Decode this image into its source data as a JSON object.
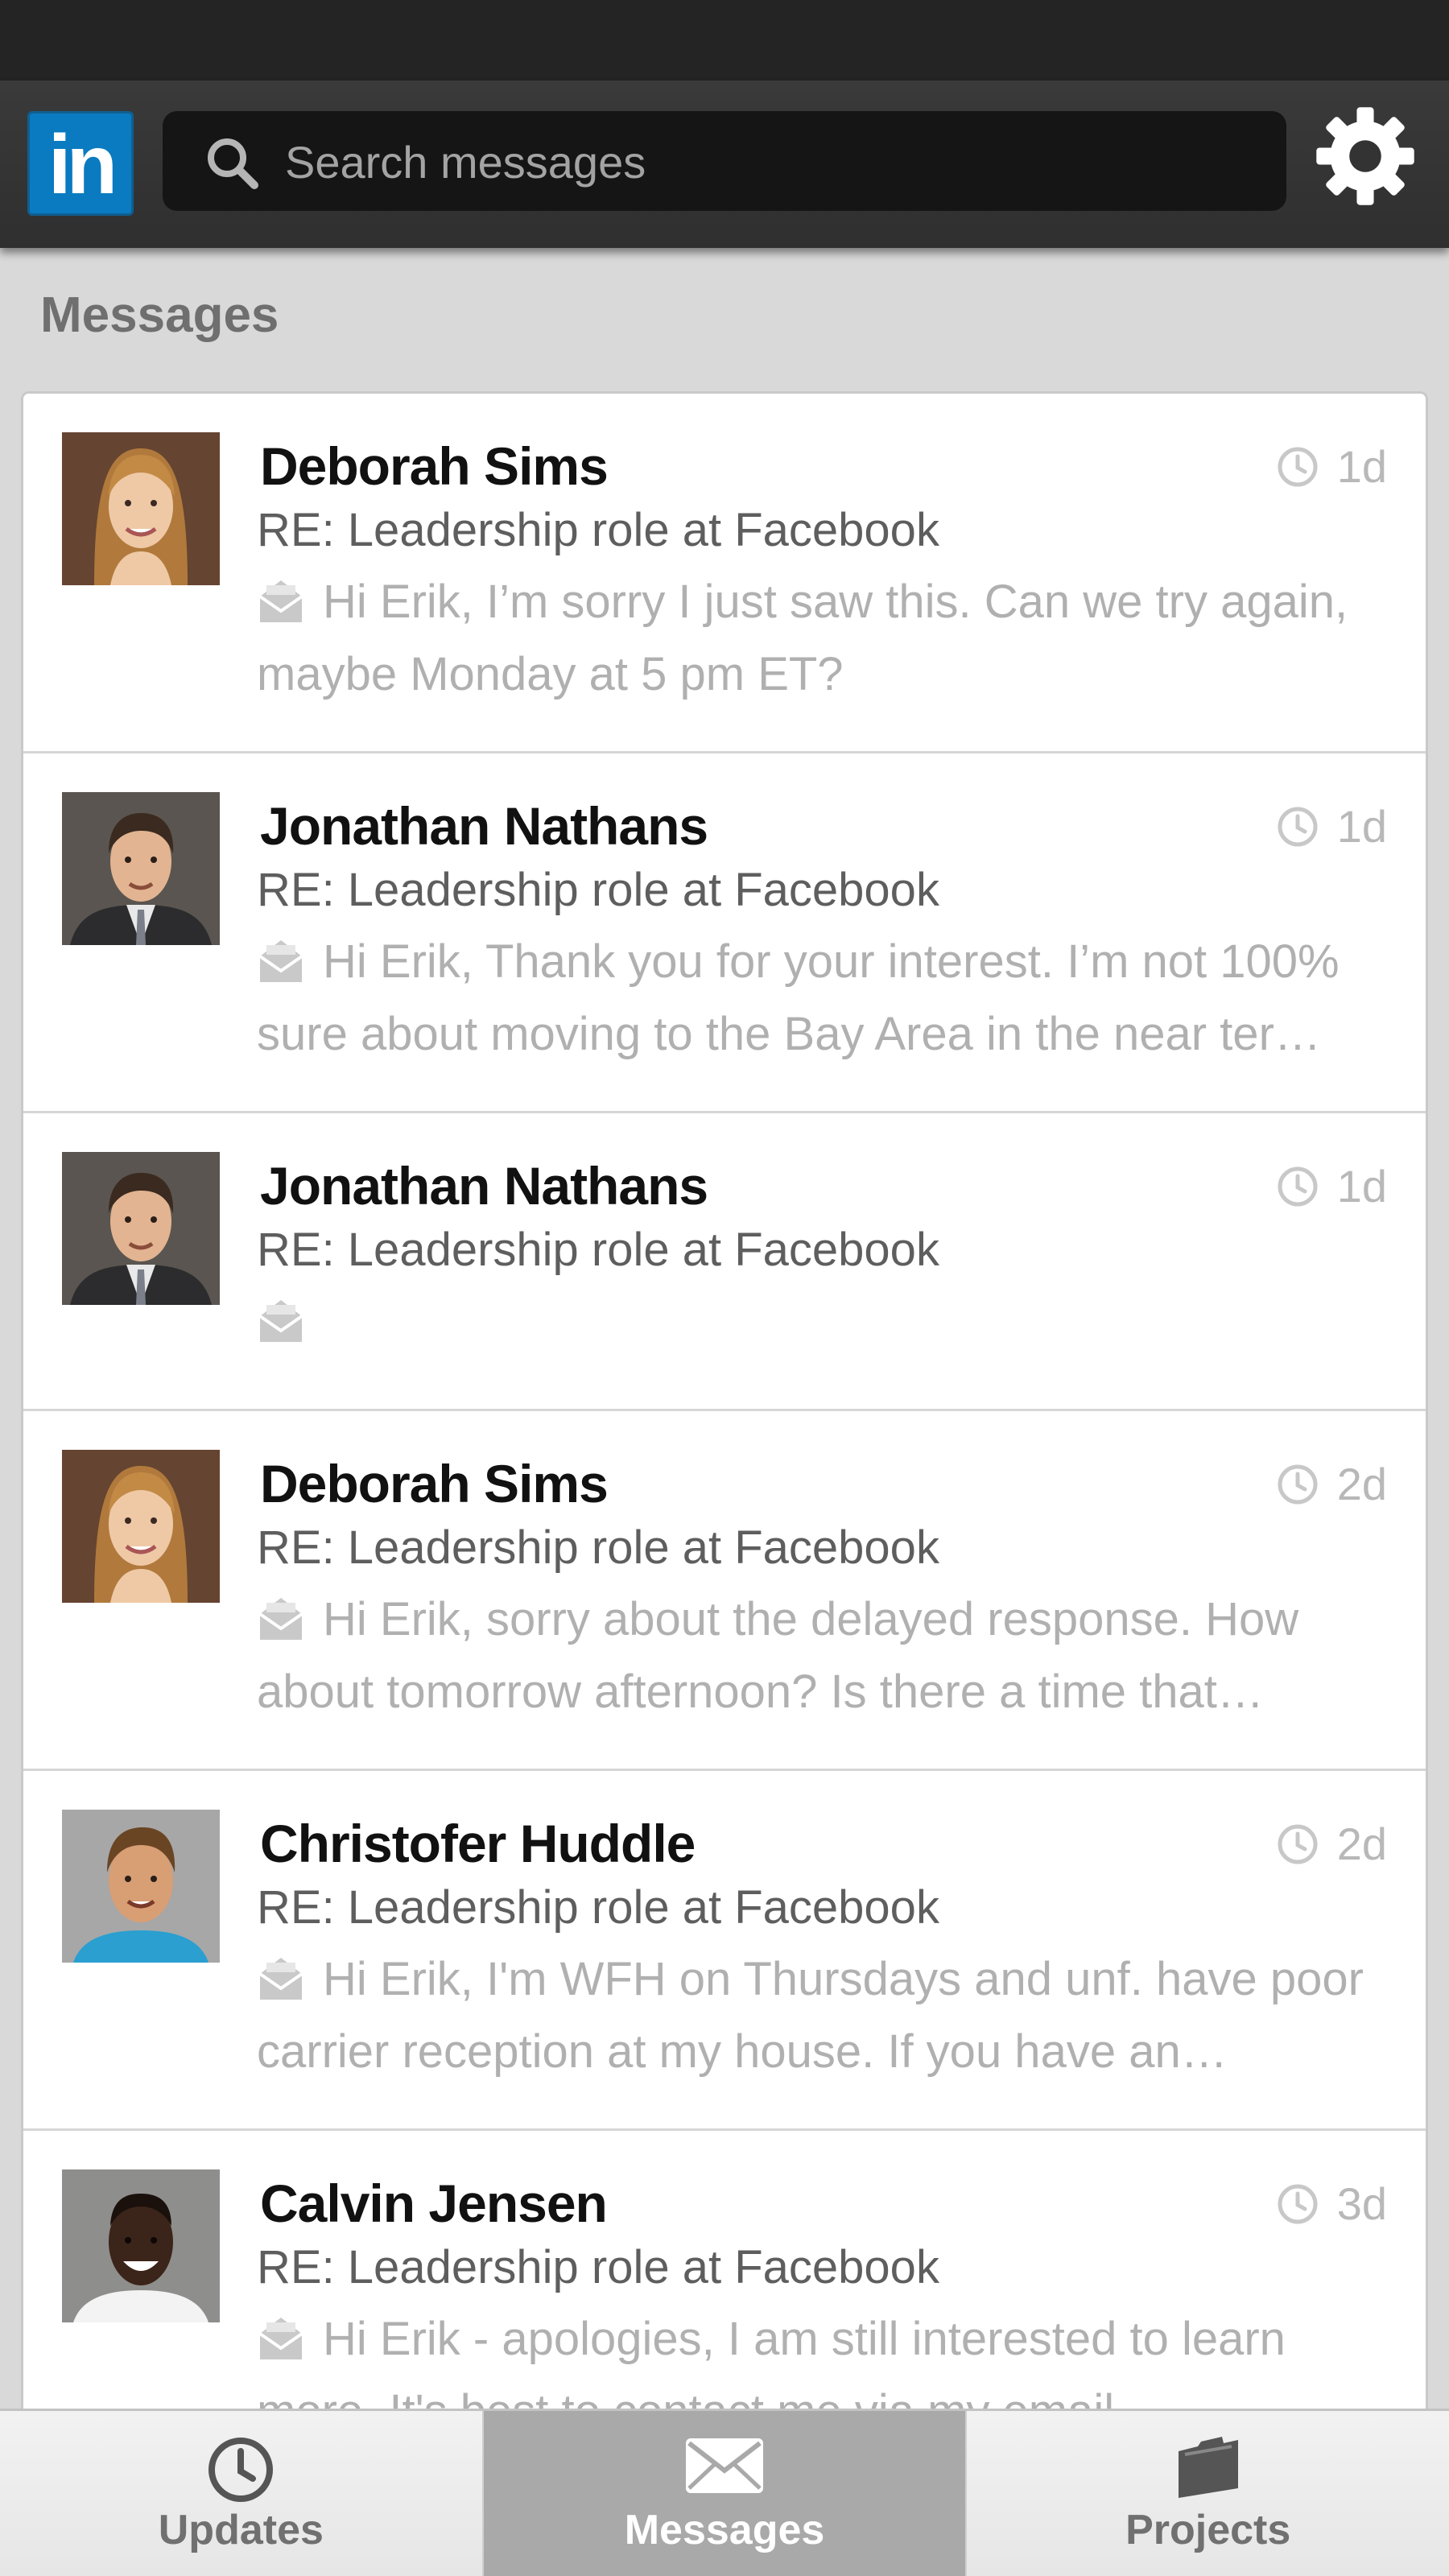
{
  "header": {
    "logo_text": "in",
    "search_placeholder": "Search messages"
  },
  "section": {
    "title": "Messages"
  },
  "messages": [
    {
      "name": "Deborah Sims",
      "time": "1d",
      "subject": "RE: Leadership role at Facebook",
      "preview": "Hi Erik, I’m sorry I just saw this. Can we try again, maybe Monday at 5 pm ET?",
      "avatar": "woman-blonde"
    },
    {
      "name": "Jonathan Nathans",
      "time": "1d",
      "subject": "RE: Leadership role at Facebook",
      "preview": "Hi Erik, Thank you for your interest. I’m not 100% sure about moving to the Bay Area in the near ter…",
      "avatar": "man-suit"
    },
    {
      "name": "Jonathan Nathans",
      "time": "1d",
      "subject": "RE: Leadership role at Facebook",
      "preview": "",
      "avatar": "man-suit"
    },
    {
      "name": "Deborah Sims",
      "time": "2d",
      "subject": "RE: Leadership role at Facebook",
      "preview": "Hi Erik, sorry about the delayed response. How about tomorrow afternoon? Is there a time that…",
      "avatar": "woman-blonde"
    },
    {
      "name": "Christofer Huddle",
      "time": "2d",
      "subject": "RE: Leadership role at Facebook",
      "preview": "Hi Erik, I'm WFH on Thursdays and unf. have poor carrier reception at my house. If you have an…",
      "avatar": "man-blue-shirt"
    },
    {
      "name": "Calvin Jensen",
      "time": "3d",
      "subject": "RE: Leadership role at Facebook",
      "preview": "Hi Erik - apologies, I am still interested to learn more. It's best to contact me via my email",
      "avatar": "man-white-shirt"
    }
  ],
  "tabs": [
    {
      "label": "Updates",
      "icon": "clock-icon",
      "active": false
    },
    {
      "label": "Messages",
      "icon": "envelope-icon",
      "active": true
    },
    {
      "label": "Projects",
      "icon": "folder-icon",
      "active": false
    }
  ],
  "colors": {
    "brand": "#0a7bc0",
    "appbar": "#333333",
    "active_tab": "#a9a9a9"
  }
}
